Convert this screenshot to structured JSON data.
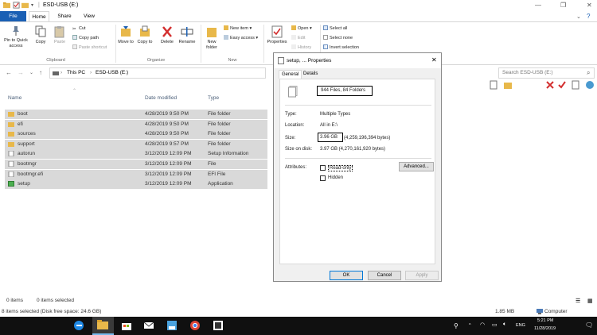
{
  "window": {
    "title": "ESD-USB (E:)",
    "minimize_glyph": "—",
    "maximize_glyph": "❐",
    "close_glyph": "✕"
  },
  "tabs": [
    "File",
    "Home",
    "Share",
    "View"
  ],
  "ribbon": {
    "pin_label": "Pin to Quick access",
    "copy_label": "Copy",
    "paste_label": "Paste",
    "cut_label": "Cut",
    "copy_path_label": "Copy path",
    "paste_shortcut_label": "Paste shortcut",
    "clipboard_group": "Clipboard",
    "move_to_label": "Move to",
    "copy_to_label": "Copy to",
    "delete_label": "Delete",
    "rename_label": "Rename",
    "organize_group": "Organize",
    "new_folder_label": "New folder",
    "new_item_label": "New item",
    "easy_access_label": "Easy access",
    "new_group": "New",
    "properties_label": "Properties",
    "open_label": "Open",
    "edit_label": "Edit",
    "history_label": "History",
    "select_all_label": "Select all",
    "select_none_label": "Select none",
    "invert_selection_label": "Invert selection"
  },
  "address": {
    "crumb1": "This PC",
    "crumb2": "ESD-USB (E:)",
    "search_placeholder": "Search ESD-USB (E:)"
  },
  "columns": {
    "name": "Name",
    "date": "Date modified",
    "type": "Type"
  },
  "files": [
    {
      "name": "boot",
      "date": "4/28/2019 9:50 PM",
      "type": "File folder",
      "kind": "folder"
    },
    {
      "name": "efi",
      "date": "4/28/2019 9:50 PM",
      "type": "File folder",
      "kind": "folder"
    },
    {
      "name": "sources",
      "date": "4/28/2019 9:50 PM",
      "type": "File folder",
      "kind": "folder"
    },
    {
      "name": "support",
      "date": "4/28/2019 9:57 PM",
      "type": "File folder",
      "kind": "folder"
    },
    {
      "name": "autorun",
      "date": "3/12/2019 12:09 PM",
      "type": "Setup Information",
      "kind": "file"
    },
    {
      "name": "bootmgr",
      "date": "3/12/2019 12:09 PM",
      "type": "File",
      "kind": "file"
    },
    {
      "name": "bootmgr.efi",
      "date": "3/12/2019 12:09 PM",
      "type": "EFI File",
      "kind": "file"
    },
    {
      "name": "setup",
      "date": "3/12/2019 12:09 PM",
      "type": "Application",
      "kind": "app"
    }
  ],
  "status": {
    "items": "0 items",
    "selected": "0 items selected",
    "size": "1.85 MB",
    "computer": "Computer",
    "footer": "8 items selected (Disk free space: 24.6 GB)"
  },
  "dialog": {
    "title": "setup, ... Properties",
    "tab_general": "General",
    "tab_details": "Details",
    "contents": "944 Files, 84 Folders",
    "type_label": "Type:",
    "type_value": "Multiple Types",
    "location_label": "Location:",
    "location_value": "All in E:\\",
    "size_label": "Size:",
    "size_value": "3.96 GB",
    "size_bytes": "(4,259,196,394 bytes)",
    "size_on_disk_label": "Size on disk:",
    "size_on_disk_value": "3.97 GB (4,270,161,920 bytes)",
    "attributes_label": "Attributes:",
    "readonly_label": "Read-only",
    "hidden_label": "Hidden",
    "advanced_label": "Advanced...",
    "ok_label": "OK",
    "cancel_label": "Cancel",
    "apply_label": "Apply"
  },
  "taskbar": {
    "time": "5:21 PM",
    "date": "11/28/2019",
    "lang": "ENG"
  },
  "colors": {
    "file_tab": "#1a5fb4",
    "folder": "#e8b84a",
    "selection": "#d9d9d9",
    "taskbar": "#101010",
    "delete_red": "#d32f2f"
  }
}
